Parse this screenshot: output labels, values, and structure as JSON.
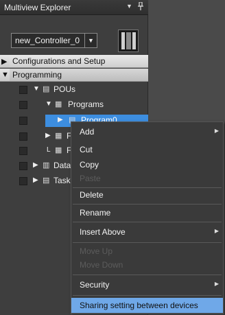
{
  "panel": {
    "title": "Multiview Explorer",
    "menu_glyph": "▼",
    "pin_glyph": "📌"
  },
  "controller": {
    "value": "new_Controller_0",
    "arrow": "▼"
  },
  "sections": {
    "config": {
      "arrow": "▶",
      "label": "Configurations and Setup"
    },
    "programming": {
      "arrow": "▼",
      "label": "Programming"
    }
  },
  "tree": {
    "pous": {
      "exp": "▼",
      "icon": "▤",
      "label": "POUs"
    },
    "programs": {
      "exp": "▼",
      "icon": "▦",
      "label": "Programs"
    },
    "program0": {
      "exp": "▶",
      "icon": "▤",
      "label": "Program0"
    },
    "fb": {
      "exp": "▶",
      "icon": "▦",
      "label": "F"
    },
    "fn": {
      "exp": "L",
      "icon": "▦",
      "label": "F"
    },
    "data": {
      "exp": "▶",
      "icon": "▥",
      "label": "Data"
    },
    "tasks": {
      "exp": "▶",
      "icon": "▤",
      "label": "Task"
    }
  },
  "context_menu": {
    "add": "Add",
    "cut": "Cut",
    "copy": "Copy",
    "paste": "Paste",
    "delete": "Delete",
    "rename": "Rename",
    "insert_above": "Insert Above",
    "move_up": "Move Up",
    "move_down": "Move Down",
    "security": "Security",
    "sharing": "Sharing setting between devices",
    "submenu_arrow": "▶"
  },
  "colors": {
    "selection": "#3d8ee0",
    "menu_highlight": "#6fa8e8",
    "disabled_text": "#5c5c5c"
  }
}
